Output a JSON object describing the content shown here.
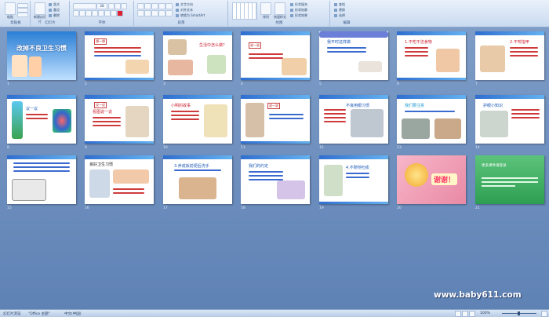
{
  "ribbon": {
    "groups": [
      {
        "title": "剪贴板"
      },
      {
        "title": "幻灯片"
      },
      {
        "title": "字体"
      },
      {
        "title": "段落"
      },
      {
        "title": "绘图"
      },
      {
        "title": "编辑"
      }
    ],
    "paste_label": "粘贴",
    "new_slide_label": "新建幻灯片",
    "layout_label": "版式",
    "reset_label": "重设",
    "delete_label": "删除",
    "font_size_value": "28",
    "text_direction_label": "文字方向",
    "align_text_label": "对齐文本",
    "smartart_label": "转换为 SmartArt",
    "arrange_label": "排列",
    "quick_styles_label": "快速样式",
    "shape_fill_label": "形状填充",
    "shape_outline_label": "形状轮廓",
    "shape_effects_label": "形状效果",
    "find_label": "查找",
    "replace_label": "替换",
    "select_label": "选择"
  },
  "slides": [
    {
      "number": "1",
      "title": "改掉不良卫生习惯"
    },
    {
      "number": "2",
      "tag": "想一想",
      "title": "看看他们做得对吗？"
    },
    {
      "number": "3",
      "title": "生活中怎么做？"
    },
    {
      "number": "4",
      "tag": "说一说",
      "title": "哪些行为不好？"
    },
    {
      "number": "5",
      "title": "我平时这样做"
    },
    {
      "number": "6",
      "title": "1.不吃不洁食物"
    },
    {
      "number": "7",
      "title": "2.不咬指甲"
    },
    {
      "number": "8",
      "title": "议一议"
    },
    {
      "number": "9",
      "tag": "议一议",
      "title": "看图说一说"
    },
    {
      "number": "10",
      "title": "小明的故事"
    },
    {
      "number": "11",
      "tag": "说一说",
      "title": "小明的习惯好吗？"
    },
    {
      "number": "12",
      "title": "不良用眼习惯"
    },
    {
      "number": "13",
      "title": "我们要注意"
    },
    {
      "number": "14",
      "title": "护眼小知识"
    },
    {
      "number": "15",
      "title": "讲卫生小故事"
    },
    {
      "number": "16",
      "title": "良好卫生习惯"
    },
    {
      "number": "17",
      "title": "3.养成饭前便后洗手"
    },
    {
      "number": "18",
      "title": "我们的约定"
    },
    {
      "number": "19",
      "title": "4.不随地吐痰"
    },
    {
      "number": "20",
      "title": "谢谢！"
    },
    {
      "number": "21",
      "title": "更多课件请登录"
    }
  ],
  "watermark_text": "www.baby611.com",
  "status": {
    "slide_sorter_label": "幻灯片浏览",
    "theme_label": "\"Office 主题\"",
    "language_label": "中文(中国)",
    "zoom_label": "100%"
  }
}
